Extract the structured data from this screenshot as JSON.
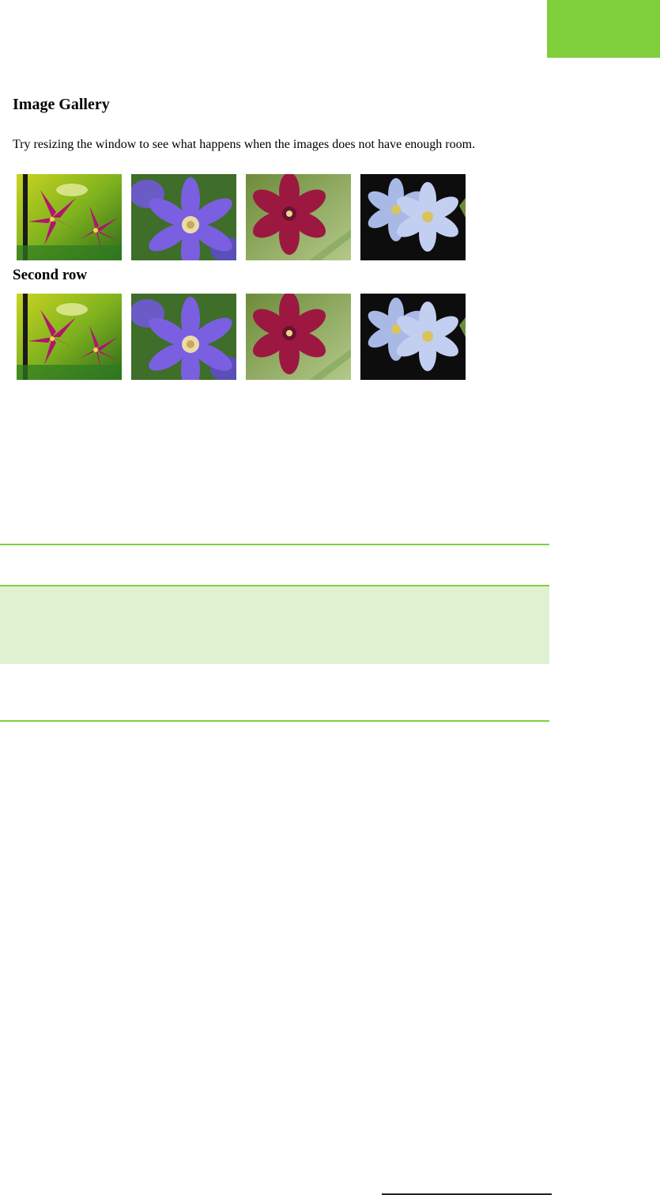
{
  "gallery": {
    "title": "Image Gallery",
    "intro": "Try resizing the window to see what happens when the images does not have enough room.",
    "second_row_label": "Second row"
  },
  "images": [
    {
      "name": "pink-lily-flower-image"
    },
    {
      "name": "purple-clematis-flower-image"
    },
    {
      "name": "red-clematis-flower-image"
    },
    {
      "name": "pale-blue-clematis-flower-image"
    }
  ],
  "colors": {
    "accent": "#7fcf3d",
    "note_background": "#dff1d0"
  }
}
